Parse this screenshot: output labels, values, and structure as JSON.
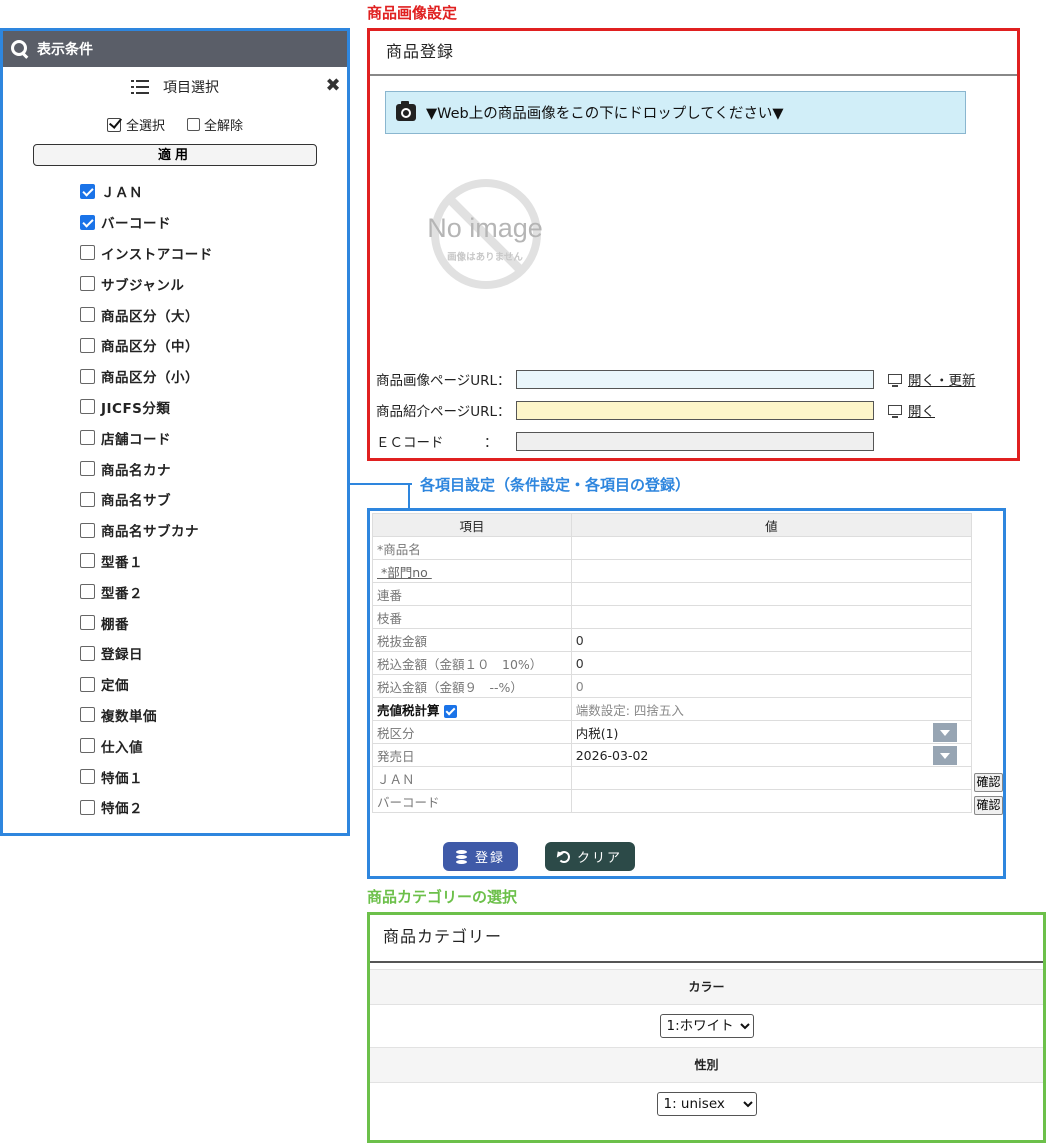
{
  "captions": {
    "image": "商品画像設定",
    "items": "各項目設定（条件設定・各項目の登録）",
    "category": "商品カテゴリーの選択"
  },
  "left_panel": {
    "header": "表示条件",
    "select_title": "項目選択",
    "close": "✖",
    "select_all": "全選択",
    "deselect_all": "全解除",
    "apply": "適用",
    "fields": [
      {
        "label": "ＪＡＮ",
        "checked": true
      },
      {
        "label": "バーコード",
        "checked": true
      },
      {
        "label": "インストアコード",
        "checked": false
      },
      {
        "label": "サブジャンル",
        "checked": false
      },
      {
        "label": "商品区分（大）",
        "checked": false
      },
      {
        "label": "商品区分（中）",
        "checked": false
      },
      {
        "label": "商品区分（小）",
        "checked": false
      },
      {
        "label": "JICFS分類",
        "checked": false
      },
      {
        "label": "店舗コード",
        "checked": false
      },
      {
        "label": "商品名カナ",
        "checked": false
      },
      {
        "label": "商品名サブ",
        "checked": false
      },
      {
        "label": "商品名サブカナ",
        "checked": false
      },
      {
        "label": "型番１",
        "checked": false
      },
      {
        "label": "型番２",
        "checked": false
      },
      {
        "label": "棚番",
        "checked": false
      },
      {
        "label": "登録日",
        "checked": false
      },
      {
        "label": "定価",
        "checked": false
      },
      {
        "label": "複数単価",
        "checked": false
      },
      {
        "label": "仕入値",
        "checked": false
      },
      {
        "label": "特価１",
        "checked": false
      },
      {
        "label": "特価２",
        "checked": false
      }
    ]
  },
  "image_panel": {
    "title": "商品登録",
    "drop_text": "▼Web上の商品画像をこの下にドロップしてください▼",
    "no_image_main": "No image",
    "no_image_sub": "画像はありません",
    "page_url_label": "商品画像ページURL：",
    "page_url_value": "",
    "page_url_link": "開く・更新",
    "intro_url_label": "商品紹介ページURL：",
    "intro_url_value": "",
    "intro_url_link": "開く",
    "ec_label": "ＥＣコード　　　：",
    "ec_value": ""
  },
  "items_panel": {
    "col_item": "項目",
    "col_value": "値",
    "rows": {
      "product_name": {
        "label": "*商品名",
        "value": ""
      },
      "dept_no": {
        "label": " *部門no ",
        "value": ""
      },
      "serial": {
        "label": "連番",
        "value": ""
      },
      "branch": {
        "label": "枝番",
        "value": ""
      },
      "price_ex": {
        "label": "税抜金額",
        "value": "0"
      },
      "price_in10": {
        "label": "税込金額（金額１０　10%）",
        "value": "0"
      },
      "price_in9": {
        "label": "税込金額（金額９　--%）",
        "value": "0"
      },
      "tax_calc": {
        "label": "売値税計算",
        "value": "端数設定: 四捨五入"
      },
      "tax_type": {
        "label": "税区分",
        "value": "内税(1)"
      },
      "release_date": {
        "label": "発売日",
        "value": "2026-03-02"
      },
      "jan": {
        "label": "ＪＡＮ",
        "value": ""
      },
      "barcode": {
        "label": "バーコード",
        "value": ""
      }
    },
    "confirm": "確認",
    "register": "登録",
    "clear": "クリア"
  },
  "category_panel": {
    "title": "商品カテゴリー",
    "color_label": "カラー",
    "color_value": "1:ホワイト",
    "gender_label": "性別",
    "gender_value": "1: unisex"
  },
  "colors": {
    "red_frame": "#e02020",
    "blue_frame": "#2e86de",
    "green_frame": "#6cc04a",
    "drop_bg": "#d1eef8",
    "intro_url_bg": "#fdf5c9",
    "page_url_bg": "#eaf6fb",
    "register_btn": "#3f5aa8",
    "clear_btn": "#2c4a48"
  }
}
